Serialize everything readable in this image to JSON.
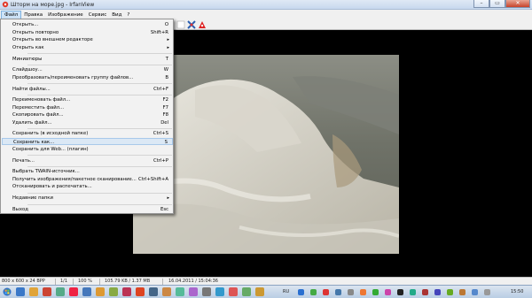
{
  "window": {
    "title": "Шторм на море.jpg - IrfanView"
  },
  "menubar": {
    "items": [
      "Файл",
      "Правка",
      "Изображение",
      "Сервис",
      "Вид",
      "?"
    ]
  },
  "file_menu": {
    "items": [
      {
        "label": "Открыть...",
        "shortcut": "O"
      },
      {
        "label": "Открыть повторно",
        "shortcut": "Shift+R"
      },
      {
        "label": "Открыть во внешнем редакторе",
        "shortcut": "",
        "submenu": true
      },
      {
        "label": "Открыть как",
        "shortcut": "",
        "submenu": true
      },
      {
        "label": "Миниатюры",
        "shortcut": "T"
      },
      {
        "label": "Слайдшоу...",
        "shortcut": "W"
      },
      {
        "label": "Преобразовать/переименовать группу файлов...",
        "shortcut": "B"
      },
      {
        "label": "Найти файлы...",
        "shortcut": "Ctrl+F"
      },
      {
        "label": "Переименовать файл...",
        "shortcut": "F2"
      },
      {
        "label": "Переместить файл...",
        "shortcut": "F7"
      },
      {
        "label": "Скопировать файл...",
        "shortcut": "F8"
      },
      {
        "label": "Удалить файл...",
        "shortcut": "Del"
      },
      {
        "label": "Сохранить (в исходной папке)",
        "shortcut": "Ctrl+S"
      },
      {
        "label": "Сохранить как...",
        "shortcut": "S"
      },
      {
        "label": "Сохранить для Web... (плагин)",
        "shortcut": ""
      },
      {
        "label": "Печать...",
        "shortcut": "Ctrl+P"
      },
      {
        "label": "Выбрать TWAIN-источник...",
        "shortcut": ""
      },
      {
        "label": "Получить изображения/пакетное сканирование...",
        "shortcut": "Ctrl+Shift+A"
      },
      {
        "label": "Отсканировать и распечатать...",
        "shortcut": ""
      },
      {
        "label": "Недавние папки",
        "shortcut": "",
        "submenu": true
      },
      {
        "label": "Выход",
        "shortcut": "Esc"
      }
    ],
    "highlighted": "Сохранить как..."
  },
  "statusbar": {
    "dimensions": "800 x 600 x 24 BPP",
    "page": "1/1",
    "zoom": "100 %",
    "filesize": "105.79 KB / 1.37 MB",
    "datetime": "16.04.2011 / 15:04:36"
  },
  "taskbar": {
    "language": "RU",
    "clock": "15:50"
  },
  "colors": {
    "menu_highlight": "#dbe8f5",
    "close_button": "#c7432a",
    "background": "#000000"
  }
}
